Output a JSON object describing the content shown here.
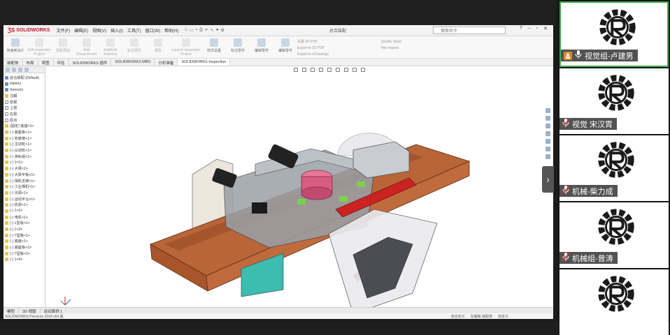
{
  "app": {
    "logo_text": "SOLIDWORKS",
    "menus": [
      "文件(F)",
      "编辑(E)",
      "视图(V)",
      "插入(I)",
      "工具(T)",
      "窗口(W)",
      "帮助(H)"
    ],
    "document_title": "总合装配",
    "search_placeholder": "搜索命令"
  },
  "ribbon": {
    "buttons": [
      {
        "label": "传递到设计",
        "faded": false
      },
      {
        "label": "Edit Inspection Project",
        "faded": true
      },
      {
        "label": "更新项目",
        "faded": true
      },
      {
        "label": "Add Characteristic",
        "faded": true
      },
      {
        "label": "Add/Edit Balloons",
        "faded": true
      },
      {
        "label": "标注零件",
        "faded": true
      },
      {
        "label": "报告",
        "faded": true
      },
      {
        "label": "Launch Inspection Project",
        "faded": true
      },
      {
        "label": "样式设置",
        "faded": false
      },
      {
        "label": "标注零件",
        "faded": false
      },
      {
        "label": "编辑零件",
        "faded": false
      },
      {
        "label": "编辑零件",
        "faded": false
      }
    ],
    "list1": [
      "设置 2D PDF",
      "Export to 3D PDF",
      "Export to eDrawings"
    ],
    "list2": [
      "Quality Xpert",
      "Net-Inspect"
    ]
  },
  "tabs": [
    "装配体",
    "布局",
    "草图",
    "评估",
    "SOLIDWORKS 插件",
    "SOLIDWORKS MBD",
    "分析准备",
    "SOLIDWORKS Inspection"
  ],
  "active_tab_index": 7,
  "tree": {
    "root": "总合装配 (Default)",
    "items": [
      "History",
      "Sensors",
      "注解",
      "前视",
      "上视",
      "右视",
      "原点",
      "(固定) 底座<1>",
      "(-) 底座板<1>",
      "(-) 安装架<1>",
      "(-) 主动轮<1>",
      "(-) 从动轮<1>",
      "(-) 滑轨组<1>",
      "(-) 1<1>",
      "(-) 大梁<1>",
      "(-) 大梁平板<1>",
      "(-) 相机支架<1>",
      "(-) 工业相机<1>",
      "(-) 光源<1>",
      "(-) 运动平台<1>",
      "(-) 机罩<1>",
      "(-) 1<2>",
      "(-) 电机<1>",
      "(-) L型板<1>",
      "(-) 1<3>",
      "(-) T型板<1>",
      "(-) 底盘<1>",
      "(-) 底座板<2>",
      "(-) T型板<2>",
      "(-) 1<4>"
    ]
  },
  "bottom_tabs": [
    "模型",
    "3D 视图",
    "运动算例 1"
  ],
  "status": {
    "left": "SOLIDWORKS Premium 2018 x64 版",
    "right": [
      "完全定义",
      "在编辑 装配体",
      "自定义"
    ]
  },
  "participants": [
    {
      "name": "视觉组-卢建男",
      "icon": "person-icon",
      "active": true
    },
    {
      "name": "视觉 宋汉霄",
      "icon": "mic-muted-icon",
      "active": false
    },
    {
      "name": "机械-柴力成",
      "icon": "mic-muted-icon",
      "active": false
    },
    {
      "name": "机械组-曾涛",
      "icon": "mic-muted-icon",
      "active": false
    },
    {
      "name": "",
      "icon": "",
      "active": false
    }
  ],
  "colors": {
    "brand": "#c8102e",
    "active_speaker": "#3fa94e",
    "wood": "#c76a3a"
  }
}
